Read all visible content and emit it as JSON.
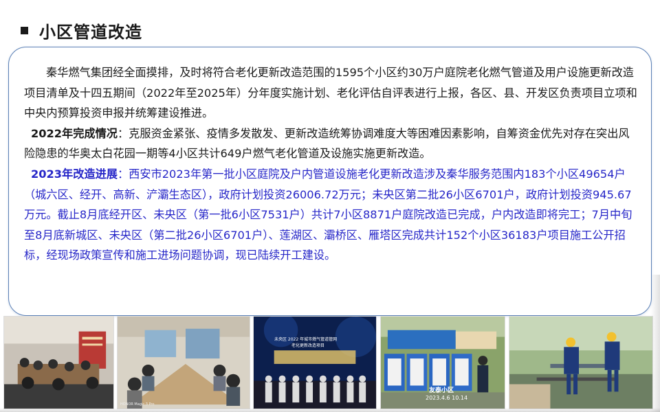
{
  "title": "小区管道改造",
  "paragraphs": {
    "intro": "秦华燃气集团经全面摸排，及时将符合老化更新改造范围的1595个小区约30万户庭院老化燃气管道及用户设施更新改造项目清单及十四五期间（2022年至2025年）分年度实施计划、老化评估自评表进行上报，各区、县、开发区负责项目立项和中央内预算投资申报并统筹建设推进。",
    "y2022_lead": "2022年完成情况",
    "y2022_body": "：克服资金紧张、疫情多发散发、更新改造统筹协调难度大等困难因素影响，自筹资金优先对存在突出风险隐患的华奥太白花园一期等4小区共计649户燃气老化管道及设施实施更新改造。",
    "y2023_lead": "2023年改造进展",
    "y2023_body": "：西安市2023年第一批小区庭院及户内管道设施老化更新改造涉及秦华服务范围内183个小区49654户（城六区、经开、高新、浐灞生态区），政府计划投资26006.72万元；未央区第二批26小区6701户，政府计划投资945.67万元。截止8月底经开区、未央区（第一批6小区7531户）共计7小区8871户庭院改造已完成，户内改造即将完工；7月中旬至8月底新城区、未央区（第二批26小区6701户）、莲湖区、灞桥区、雁塔区完成共计152个小区36183户项目施工公开招标，经现场政策宣传和施工进场问题协调，现已陆续开工建设。"
  },
  "photos": [
    {
      "name": "meeting-room-photo-1"
    },
    {
      "name": "meeting-room-photo-2",
      "camera_mark": "HONOR Magic 3 Pro"
    },
    {
      "name": "launch-ceremony-photo",
      "banner_line1": "未央区 2022 年城市燃气管道管网",
      "banner_line2": "老化更新改造项目"
    },
    {
      "name": "site-signboard-photo",
      "place": "友泰小区",
      "timestamp": "2023.4.6 10.14"
    },
    {
      "name": "pipe-welding-photo"
    }
  ],
  "colors": {
    "text": "#1a1a1a",
    "accent_blue": "#2626c8",
    "box_border": "#5a7fb5"
  }
}
